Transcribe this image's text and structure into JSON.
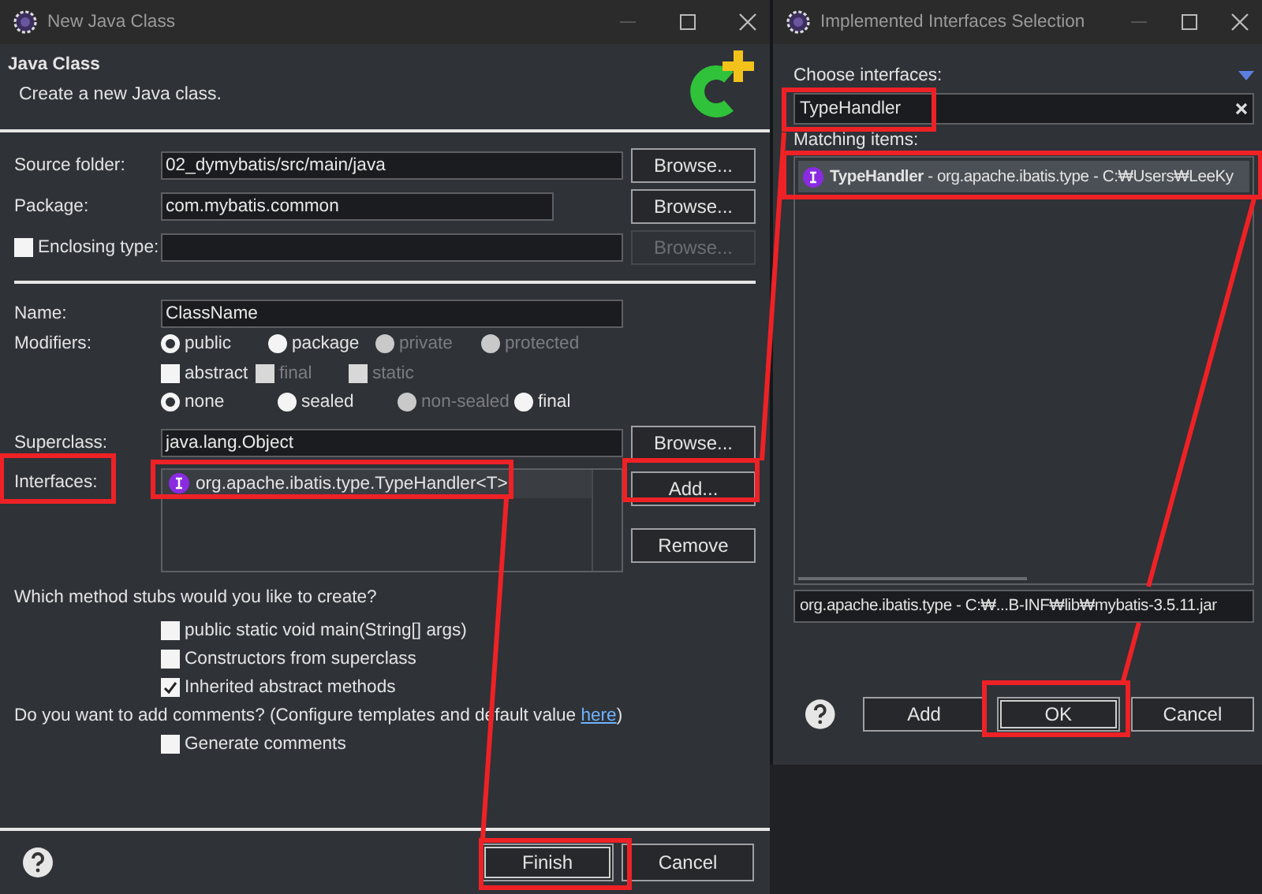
{
  "new_class_dialog": {
    "title": "New Java Class",
    "heading": "Java Class",
    "description": "Create a new Java class.",
    "location_rows": [
      {
        "kind": "field",
        "label": "Source folder:",
        "value": "02_dymybatis/src/main/java",
        "button": {
          "label": "Browse...",
          "disabled": false
        }
      },
      {
        "kind": "short_field",
        "label": "Package:",
        "value": "com.mybatis.common",
        "button": {
          "label": "Browse...",
          "disabled": false
        }
      },
      {
        "kind": "check_field",
        "label": "Enclosing type:",
        "checked": false,
        "button": {
          "label": "Browse...",
          "disabled": true
        }
      }
    ],
    "name": {
      "label": "Name:",
      "value": "ClassName"
    },
    "modifiers": {
      "label": "Modifiers:",
      "rows": [
        [
          {
            "kind": "radio",
            "label": "public",
            "selected": true,
            "disabled": false
          },
          {
            "kind": "radio",
            "label": "package",
            "selected": false,
            "disabled": false
          },
          {
            "kind": "radio",
            "label": "private",
            "selected": false,
            "disabled": true
          },
          {
            "kind": "radio",
            "label": "protected",
            "selected": false,
            "disabled": true
          }
        ],
        [
          {
            "kind": "checkbox",
            "label": "abstract",
            "checked": false,
            "disabled": false
          },
          {
            "kind": "checkbox",
            "label": "final",
            "checked": false,
            "disabled": true
          },
          {
            "kind": "checkbox",
            "label": "static",
            "checked": false,
            "disabled": true
          }
        ],
        [
          {
            "kind": "radio",
            "label": "none",
            "selected": true,
            "disabled": false
          },
          {
            "kind": "radio",
            "label": "sealed",
            "selected": false,
            "disabled": false
          },
          {
            "kind": "radio",
            "label": "non-sealed",
            "selected": false,
            "disabled": true
          },
          {
            "kind": "radio",
            "label": "final",
            "selected": false,
            "disabled": false
          }
        ]
      ]
    },
    "superclass": {
      "label": "Superclass:",
      "value": "java.lang.Object",
      "button": "Browse..."
    },
    "interfaces": {
      "label": "Interfaces:",
      "items": [
        "org.apache.ibatis.type.TypeHandler<T>"
      ],
      "buttons": [
        "Add...",
        "Remove"
      ]
    },
    "stubs": {
      "prompt": "Which method stubs would you like to create?",
      "options": [
        {
          "label": "public static void main(String[] args)",
          "checked": false
        },
        {
          "label": "Constructors from superclass",
          "checked": false
        },
        {
          "label": "Inherited abstract methods",
          "checked": true
        }
      ]
    },
    "comments": {
      "prompt": "Do you want to add comments? (Configure templates and default value",
      "link": "here",
      "closing": ")",
      "options": [
        {
          "label": "Generate comments",
          "checked": false
        }
      ]
    },
    "buttons": [
      {
        "label": "Finish",
        "default": true
      },
      {
        "label": "Cancel",
        "default": false
      }
    ]
  },
  "selection_dialog": {
    "title": "Implemented Interfaces Selection",
    "filter_label": "Choose interfaces:",
    "filter_value": "TypeHandler",
    "list_label": "Matching items:",
    "items": [
      {
        "label": "**TypeHandler** - org.apache.ibatis.type - C:₩Users₩LeeKy",
        "selected": true
      }
    ],
    "location": "org.apache.ibatis.type - C:₩...B-INF₩lib₩mybatis-3.5.11.jar",
    "buttons": [
      {
        "label": "Add",
        "default": false
      },
      {
        "label": "OK",
        "default": true
      },
      {
        "label": "Cancel",
        "default": false
      }
    ]
  }
}
